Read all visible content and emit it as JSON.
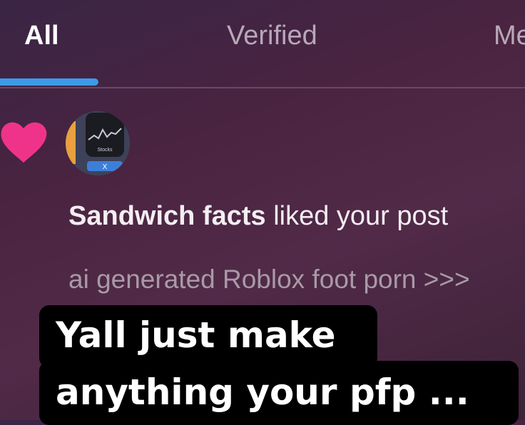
{
  "tabs": [
    {
      "label": "All",
      "active": true
    },
    {
      "label": "Verified",
      "active": false
    },
    {
      "label": "Me",
      "active": false
    }
  ],
  "colors": {
    "accent": "#3d9ae8",
    "heart": "#f0338a"
  },
  "notification": {
    "type_icon": "heart-icon",
    "avatar_label": "Stocks",
    "user": "Sandwich facts",
    "action": " liked your post",
    "post_preview": "ai generated Roblox foot porn >>>"
  },
  "caption": {
    "line1": "Yall just make",
    "line2": "anything your pfp ..."
  }
}
